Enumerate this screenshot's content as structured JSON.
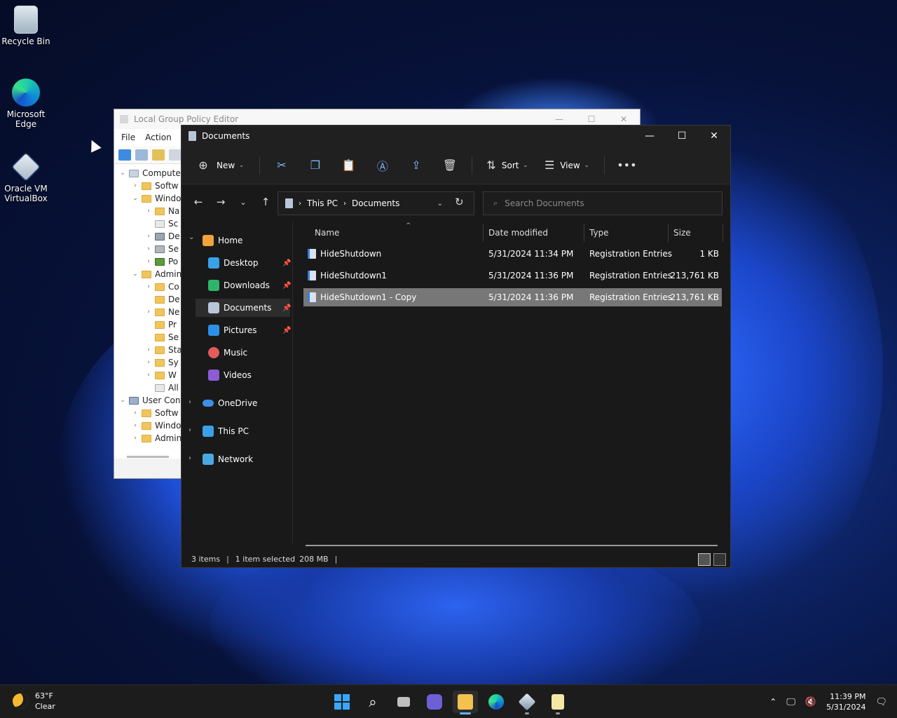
{
  "desktop": {
    "icons": [
      {
        "label": "Recycle Bin"
      },
      {
        "label": "Microsoft Edge"
      },
      {
        "label": "Oracle VM VirtualBox"
      }
    ]
  },
  "gpe": {
    "title": "Local Group Policy Editor",
    "menu": [
      "File",
      "Action"
    ],
    "tree": [
      {
        "label": "Compute"
      },
      {
        "label": "Softw"
      },
      {
        "label": "Windo"
      },
      {
        "label": "Na"
      },
      {
        "label": "Sc"
      },
      {
        "label": "De"
      },
      {
        "label": "Se"
      },
      {
        "label": "Po"
      },
      {
        "label": "Admin"
      },
      {
        "label": "Co"
      },
      {
        "label": "De"
      },
      {
        "label": "Ne"
      },
      {
        "label": "Pr"
      },
      {
        "label": "Se"
      },
      {
        "label": "Sta"
      },
      {
        "label": "Sy"
      },
      {
        "label": "W"
      },
      {
        "label": "All"
      },
      {
        "label": "User Conf"
      },
      {
        "label": "Softw"
      },
      {
        "label": "Windo"
      },
      {
        "label": "Admin"
      }
    ]
  },
  "explorer": {
    "title": "Documents",
    "cmd": {
      "new_label": "New",
      "sort_label": "Sort",
      "view_label": "View"
    },
    "address": {
      "crumbs": [
        "This PC",
        "Documents"
      ]
    },
    "search": {
      "placeholder": "Search Documents"
    },
    "nav": {
      "home": "Home",
      "quick": [
        {
          "label": "Desktop",
          "pinned": true
        },
        {
          "label": "Downloads",
          "pinned": true
        },
        {
          "label": "Documents",
          "pinned": true,
          "selected": true
        },
        {
          "label": "Pictures",
          "pinned": true
        },
        {
          "label": "Music",
          "pinned": false
        },
        {
          "label": "Videos",
          "pinned": false
        }
      ],
      "onedrive": "OneDrive",
      "thispc": "This PC",
      "network": "Network"
    },
    "columns": {
      "name": "Name",
      "date": "Date modified",
      "type": "Type",
      "size": "Size"
    },
    "files": [
      {
        "name": "HideShutdown",
        "date": "5/31/2024 11:34 PM",
        "type": "Registration Entries",
        "size": "1 KB",
        "selected": false
      },
      {
        "name": "HideShutdown1",
        "date": "5/31/2024 11:36 PM",
        "type": "Registration Entries",
        "size": "213,761 KB",
        "selected": false
      },
      {
        "name": "HideShutdown1 - Copy",
        "date": "5/31/2024 11:36 PM",
        "type": "Registration Entries",
        "size": "213,761 KB",
        "selected": true
      }
    ],
    "status": {
      "items": "3 items",
      "selected": "1 item selected",
      "size": "208 MB"
    }
  },
  "taskbar": {
    "weather": {
      "temp": "63°F",
      "desc": "Clear"
    },
    "clock": {
      "time": "11:39 PM",
      "date": "5/31/2024"
    }
  },
  "colors": {
    "accent": "#5fb2ff",
    "selection": "#777777"
  }
}
